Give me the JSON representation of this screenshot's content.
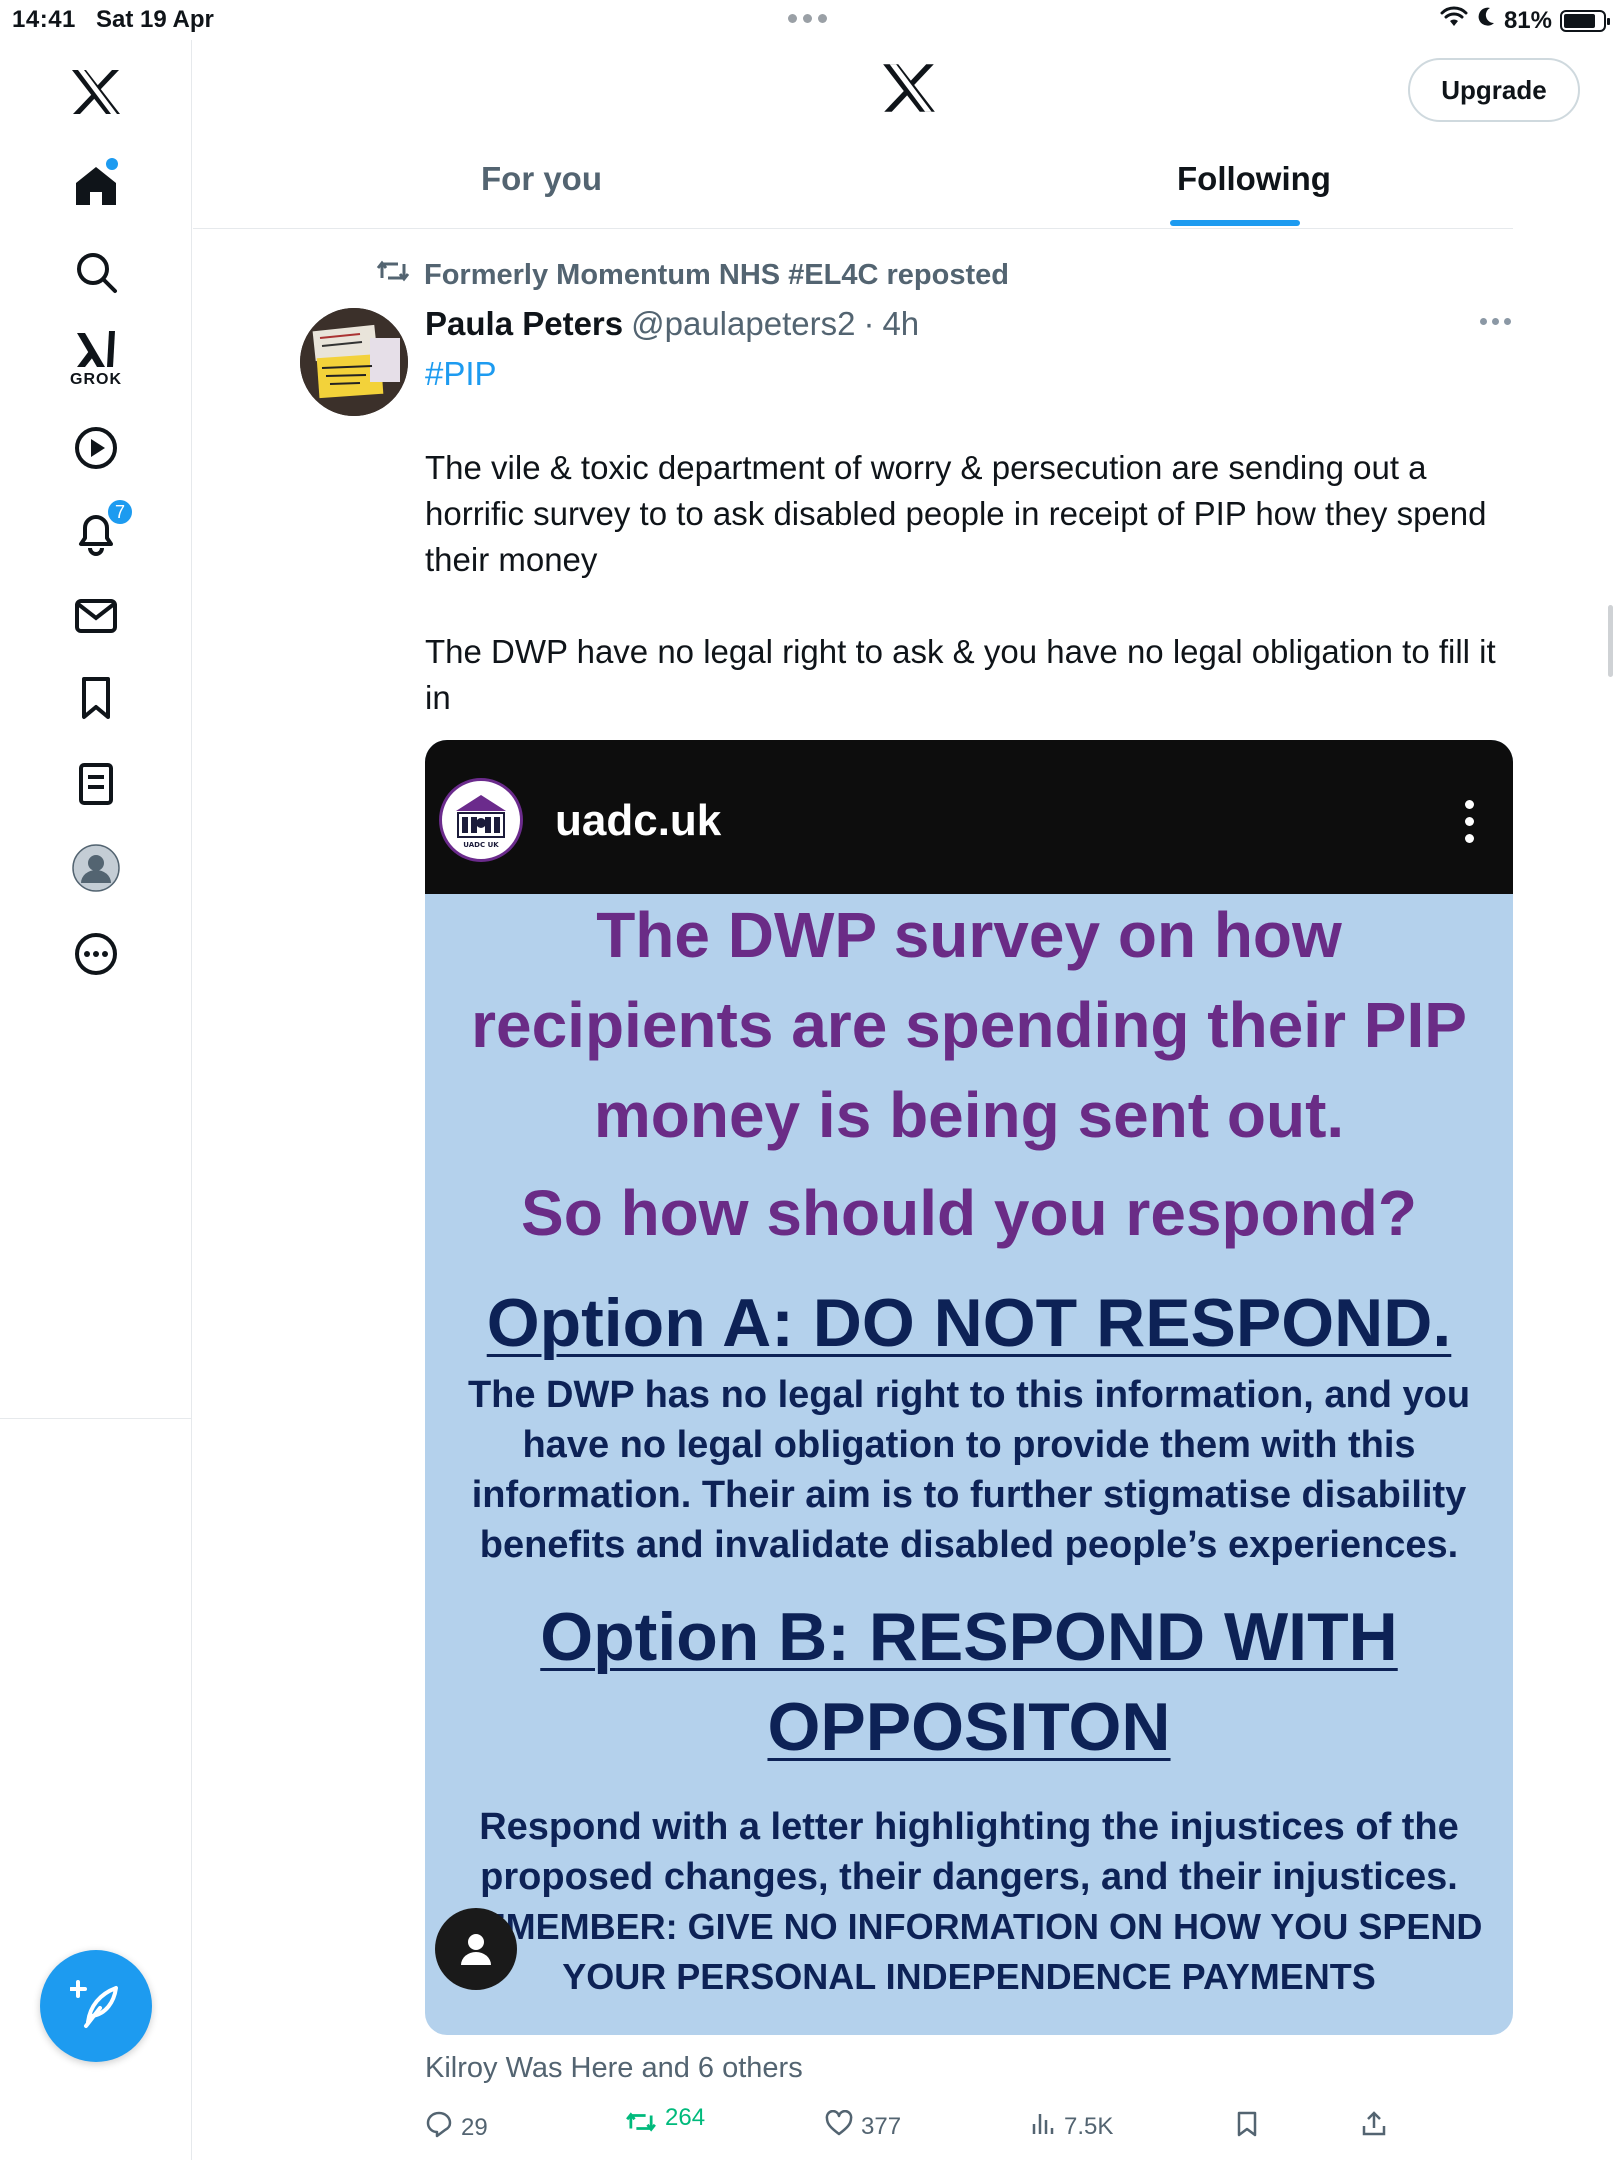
{
  "status_bar": {
    "time": "14:41",
    "date": "Sat 19 Apr",
    "battery_text": "81%",
    "battery_level": 0.81
  },
  "sidebar": {
    "items": [
      {
        "name": "x-logo",
        "icon": "x-logo-icon"
      },
      {
        "name": "home",
        "icon": "home-icon",
        "has_dot": true
      },
      {
        "name": "explore",
        "icon": "search-icon"
      },
      {
        "name": "grok",
        "icon": "grok-icon",
        "label": "GROK"
      },
      {
        "name": "videos",
        "icon": "play-icon"
      },
      {
        "name": "notifications",
        "icon": "bell-icon",
        "badge": "7"
      },
      {
        "name": "messages",
        "icon": "mail-icon"
      },
      {
        "name": "bookmarks",
        "icon": "bookmark-icon"
      },
      {
        "name": "lists",
        "icon": "list-icon"
      },
      {
        "name": "profile",
        "icon": "avatar-icon"
      },
      {
        "name": "more",
        "icon": "more-icon"
      }
    ],
    "compose_icon": "compose-icon"
  },
  "header": {
    "upgrade_label": "Upgrade",
    "tabs": [
      {
        "label": "For you",
        "active": false
      },
      {
        "label": "Following",
        "active": true
      }
    ]
  },
  "post": {
    "repost_text": "Formerly Momentum NHS #EL4C reposted",
    "author_name": "Paula Peters",
    "author_handle": "@paulapeters2",
    "separator": "·",
    "time": "4h",
    "hashtag": "#PIP",
    "body_1": "The vile & toxic department of worry & persecution are sending out a horrific survey to to ask disabled people in receipt of PIP how they spend their money",
    "body_2": "The DWP have no legal right to ask & you have no legal obligation to fill it in",
    "media": {
      "site": "uadc.uk",
      "logo_text": "UADC UK",
      "headline_1": "The DWP survey on how recipients are spending their PIP money is being sent out.",
      "headline_2": "So how should you respond?",
      "option_a_title": "Option A: DO NOT RESPOND.",
      "option_a_text": "The DWP has no legal right to this information, and you have no legal obligation to provide them with this information.  Their aim is to further stigmatise disability benefits and invalidate disabled people’s experiences.",
      "option_b_title": "Option B: RESPOND WITH OPPOSITON",
      "option_b_text": "Respond with a letter highlighting the injustices of the proposed changes, their dangers, and their injustices.",
      "remember_text": "REMEMBER: GIVE NO INFORMATION ON HOW YOU SPEND YOUR PERSONAL INDEPENDENCE PAYMENTS"
    },
    "liked_by": "Kilroy Was Here and 6 others",
    "stats": {
      "replies": "29",
      "reposts": "264",
      "likes": "377",
      "views": "7.5K"
    }
  },
  "colors": {
    "accent": "#1d9bf0",
    "muted_text": "#536471",
    "repost_green": "#00ba7c",
    "media_bg": "#b4d1ec",
    "media_purple": "#6a2c86",
    "media_navy": "#0d2256"
  }
}
